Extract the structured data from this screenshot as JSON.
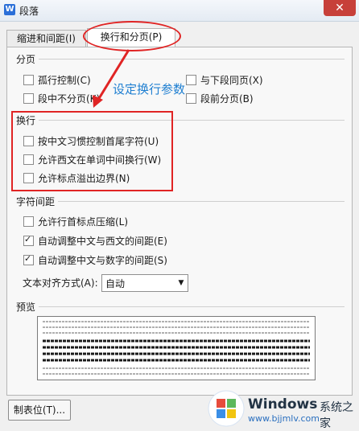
{
  "titlebar": {
    "app_icon": "W",
    "title": "段落",
    "close": "✕"
  },
  "tabs": [
    {
      "label": "缩进和间距(I)"
    },
    {
      "label": "换行和分页(P)"
    }
  ],
  "pagination": {
    "title": "分页",
    "widow_control": "孤行控制(C)",
    "keep_with_next": "与下段同页(X)",
    "keep_lines_together": "段中不分页(K)",
    "page_break_before": "段前分页(B)"
  },
  "line_break": {
    "title": "换行",
    "items": [
      "按中文习惯控制首尾字符(U)",
      "允许西文在单词中间换行(W)",
      "允许标点溢出边界(N)"
    ]
  },
  "char_spacing": {
    "title": "字符间距",
    "items": [
      {
        "label": "允许行首标点压缩(L)",
        "checked": false
      },
      {
        "label": "自动调整中文与西文的间距(E)",
        "checked": true
      },
      {
        "label": "自动调整中文与数字的间距(S)",
        "checked": true
      }
    ],
    "align_label": "文本对齐方式(A):",
    "align_value": "自动"
  },
  "preview": {
    "title": "预览"
  },
  "buttons": {
    "tabstops": "制表位(T)..."
  },
  "annotation": {
    "text": "设定换行参数",
    "color": "#e02424"
  },
  "watermark": {
    "title": "Windows",
    "cn": "系统之家",
    "url": "www.bjjmlv.com"
  }
}
